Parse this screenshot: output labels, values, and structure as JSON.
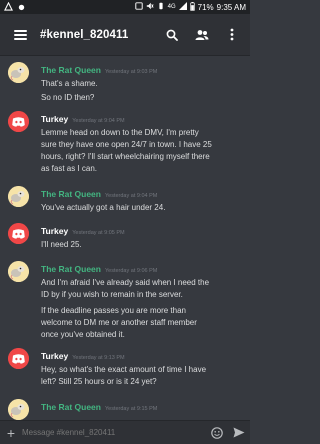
{
  "status_bar": {
    "battery": "71%",
    "time": "9:35 AM",
    "network": "4G"
  },
  "header": {
    "channel": "#kennel_820411",
    "icons": [
      "hamburger-menu-icon",
      "search-icon",
      "members-icon",
      "more-vertical-icon"
    ]
  },
  "messages": [
    {
      "author": "The Rat Queen",
      "timestamp": "Yesterday at 9:03 PM",
      "lines": [
        "That's a shame.",
        "So no ID then?"
      ]
    },
    {
      "author": "Turkey",
      "timestamp": "Yesterday at 9:04 PM",
      "lines": [
        "Lemme head on down to the DMV, I'm pretty",
        "sure they have one open 24/7 in town. I have 25",
        "hours, right? I'll start wheelchairing myself there",
        "as fast as I can."
      ]
    },
    {
      "author": "The Rat Queen",
      "timestamp": "Yesterday at 9:04 PM",
      "lines": [
        "You've actually got a hair under 24."
      ]
    },
    {
      "author": "Turkey",
      "timestamp": "Yesterday at 9:05 PM",
      "lines": [
        "I'll need 25."
      ]
    },
    {
      "author": "The Rat Queen",
      "timestamp": "Yesterday at 9:06 PM",
      "lines": [
        "And I'm afraid I've already said when I need the",
        "ID by if you wish to remain in the server.",
        "If the deadline passes you are more than",
        "welcome to DM me or another staff member",
        "once you've obtained it."
      ]
    },
    {
      "author": "Turkey",
      "timestamp": "Yesterday at 9:13 PM",
      "lines": [
        "Hey, so what's the exact amount of time I have",
        "left? Still 25 hours or is it 24 yet?"
      ]
    },
    {
      "author": "The Rat Queen",
      "timestamp": "Yesterday at 9:15 PM",
      "lines": []
    }
  ],
  "composer": {
    "placeholder": "Message #kennel_820411",
    "plus": "+"
  }
}
